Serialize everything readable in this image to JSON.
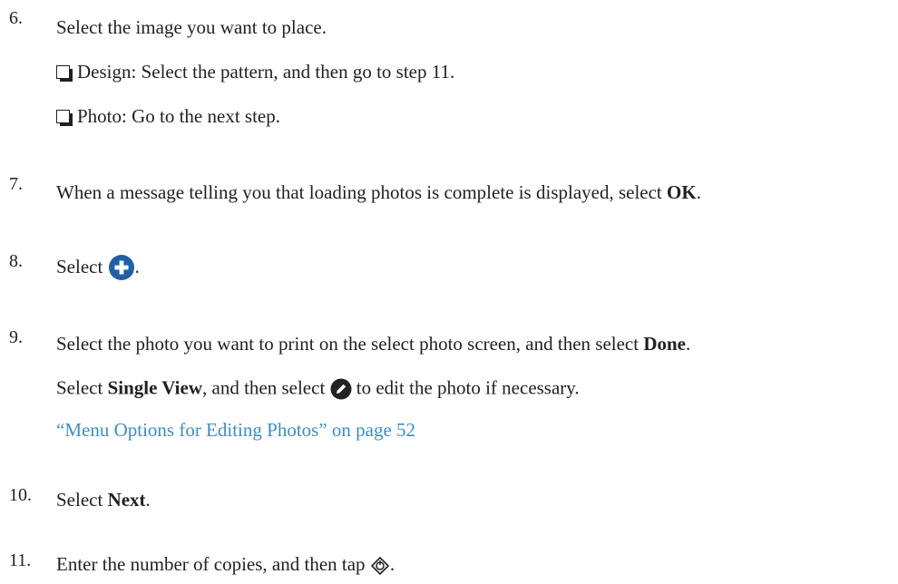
{
  "steps": [
    {
      "number": "6.",
      "text": "Select the image you want to place.",
      "bullets": [
        "Design: Select the pattern, and then go to step 11.",
        "Photo: Go to the next step."
      ]
    },
    {
      "number": "7.",
      "text_before": "When a message telling you that loading photos is complete is displayed, select ",
      "bold": "OK",
      "text_after": "."
    },
    {
      "number": "8.",
      "text_before": "Select ",
      "icon": "add-circle-icon",
      "text_after": "."
    },
    {
      "number": "9.",
      "text_before": "Select the photo you want to print on the select photo screen, and then select ",
      "bold": "Done",
      "text_after": ".",
      "note_before": "Select ",
      "note_bold": "Single View",
      "note_middle": ", and then select ",
      "note_icon": "edit-pencil-icon",
      "note_after": " to edit the photo if necessary.",
      "link": "“Menu Options for Editing Photos” on page 52"
    },
    {
      "number": "10.",
      "text_before": "Select ",
      "bold": "Next",
      "text_after": "."
    },
    {
      "number": "11.",
      "text_before": "Enter the number of copies, and then tap ",
      "icon": "start-diamond-icon",
      "text_after": "."
    }
  ],
  "colors": {
    "text": "#231f20",
    "link": "#3b8ec9",
    "icon": "#1f5fa8"
  }
}
